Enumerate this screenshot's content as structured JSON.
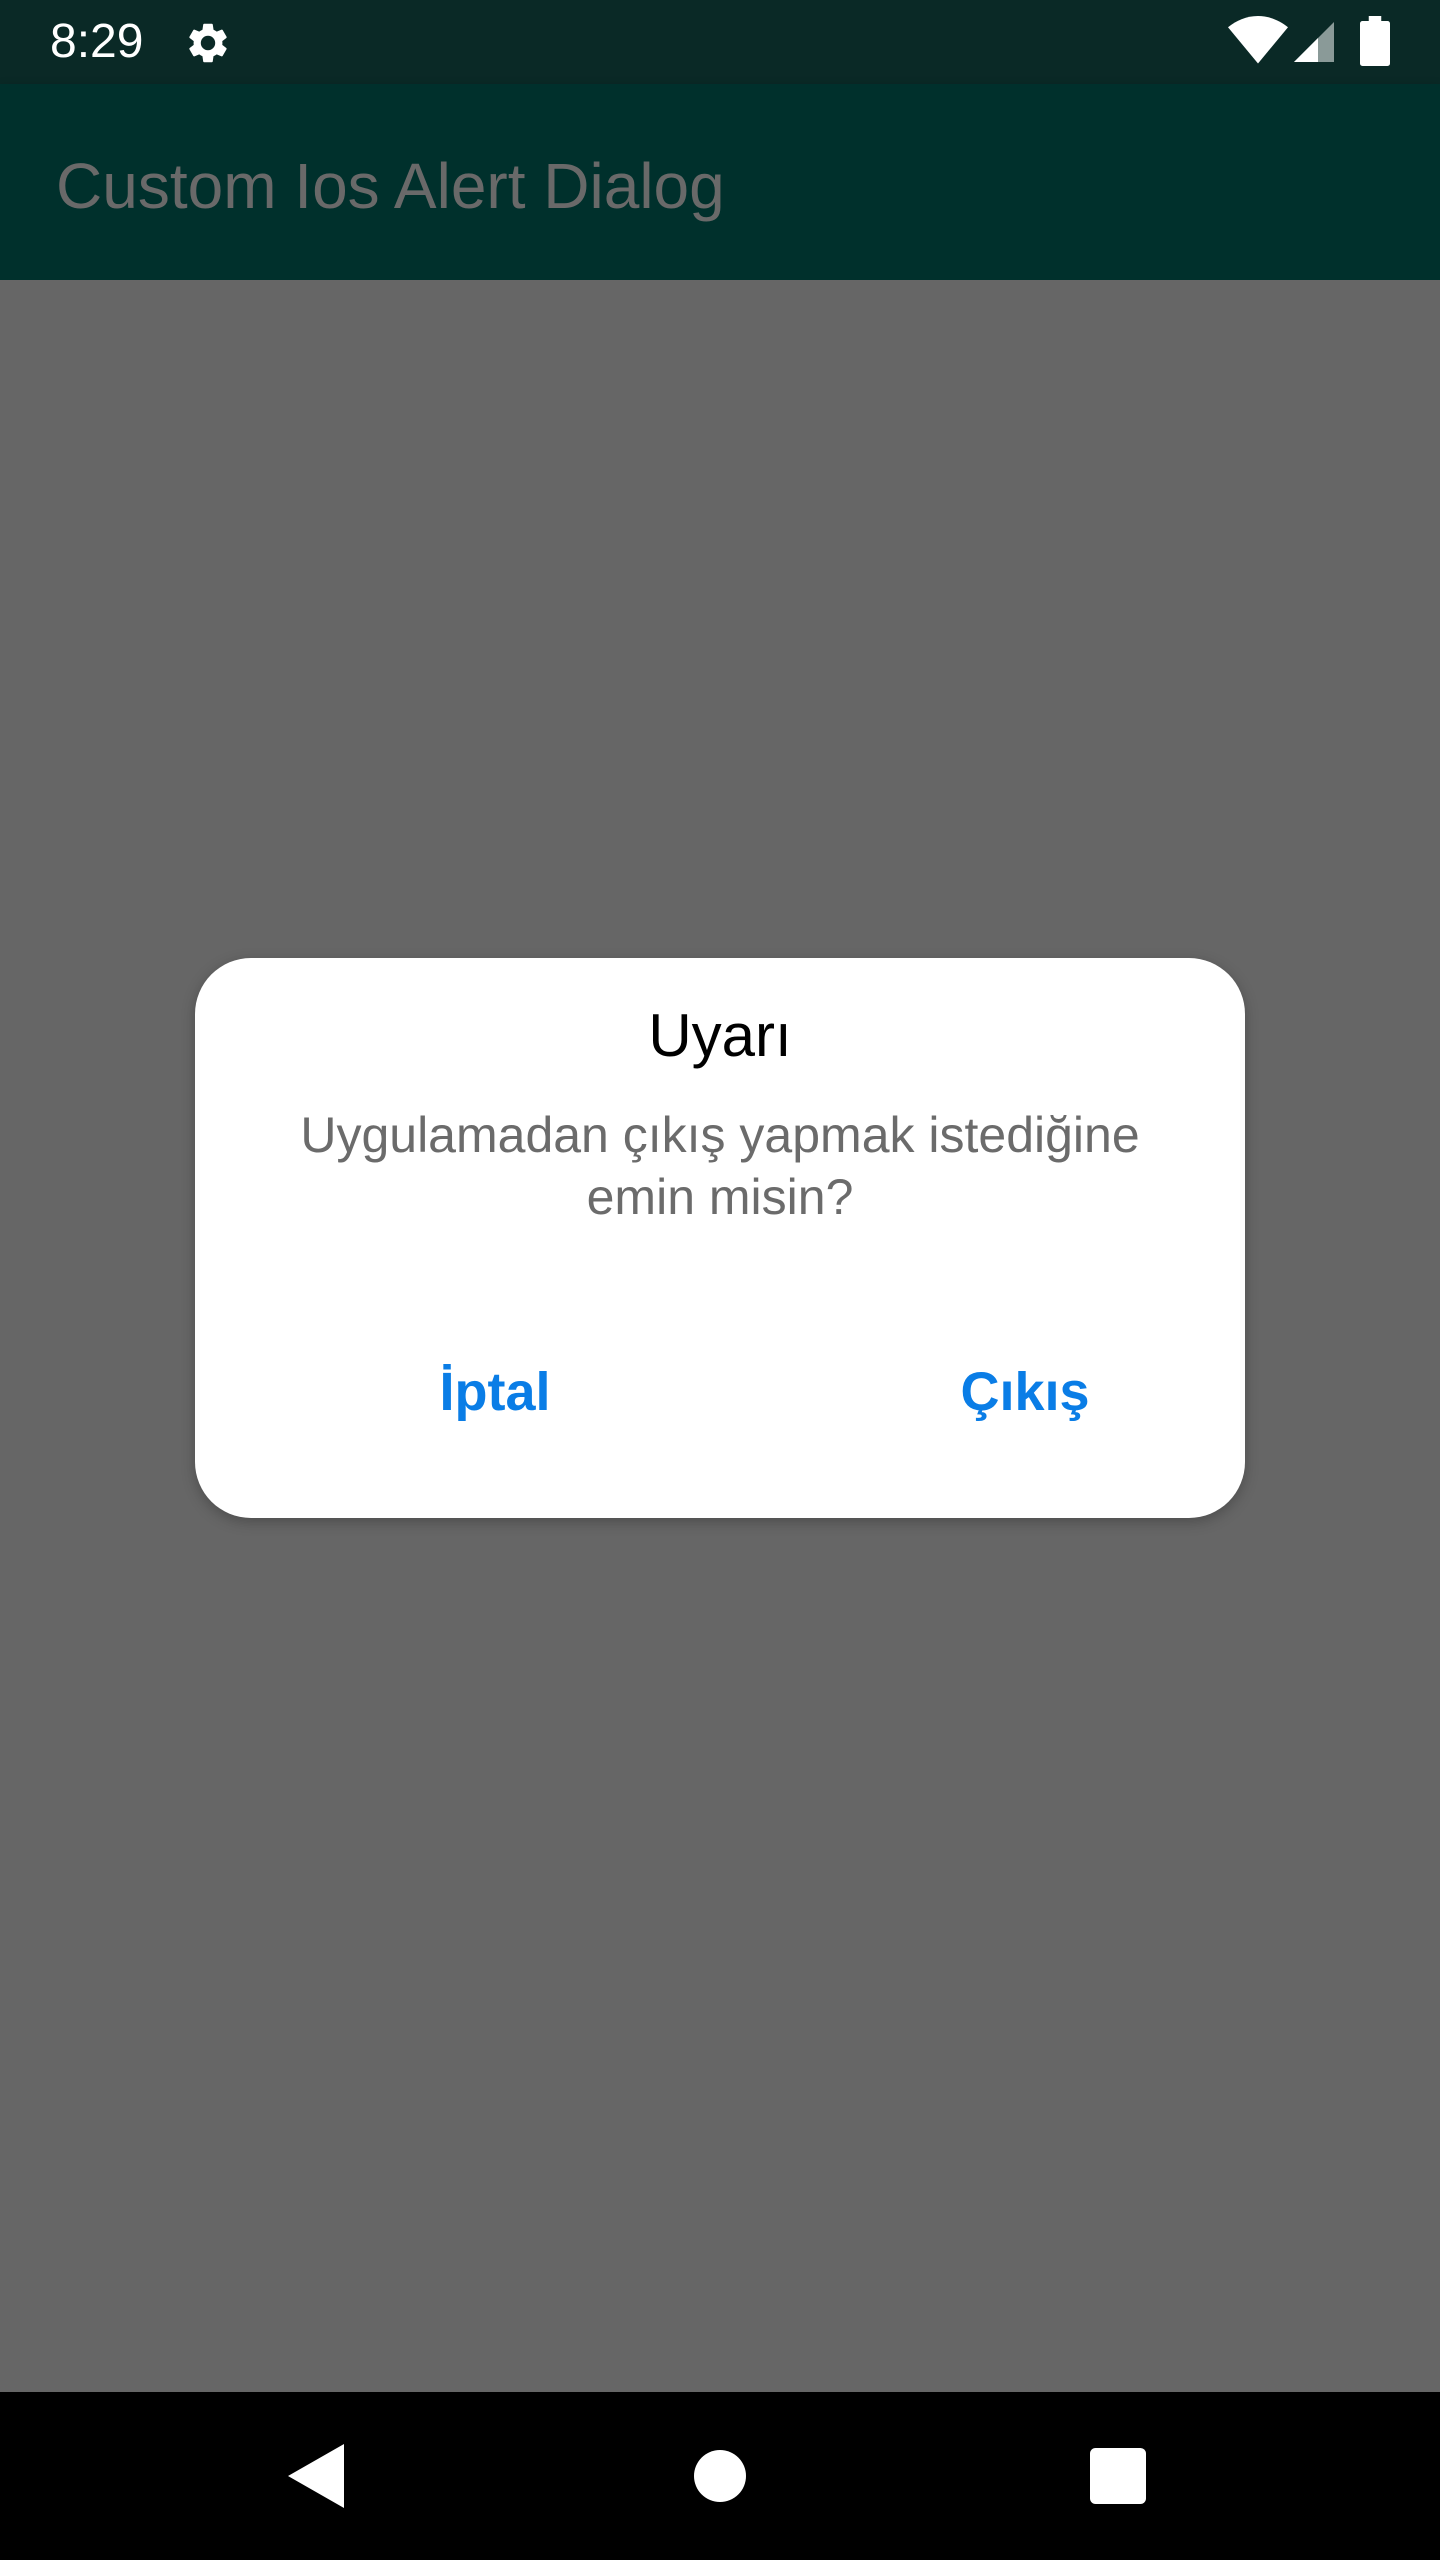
{
  "status_bar": {
    "time": "8:29",
    "icons": [
      "gear-icon",
      "wifi-icon",
      "signal-icon",
      "battery-icon"
    ]
  },
  "app_bar": {
    "title": "Custom Ios Alert Dialog"
  },
  "dialog": {
    "title": "Uyarı",
    "message": "Uygulamadan çıkış yapmak istediğine emin misin?",
    "cancel_label": "İptal",
    "exit_label": "Çıkış"
  },
  "nav_bar": {
    "icons": [
      "back-icon",
      "home-icon",
      "recents-icon"
    ]
  },
  "colors": {
    "status_bar": "#0a2926",
    "app_bar": "#00302c",
    "overlay": "#666666",
    "accent": "#0a7de6"
  }
}
